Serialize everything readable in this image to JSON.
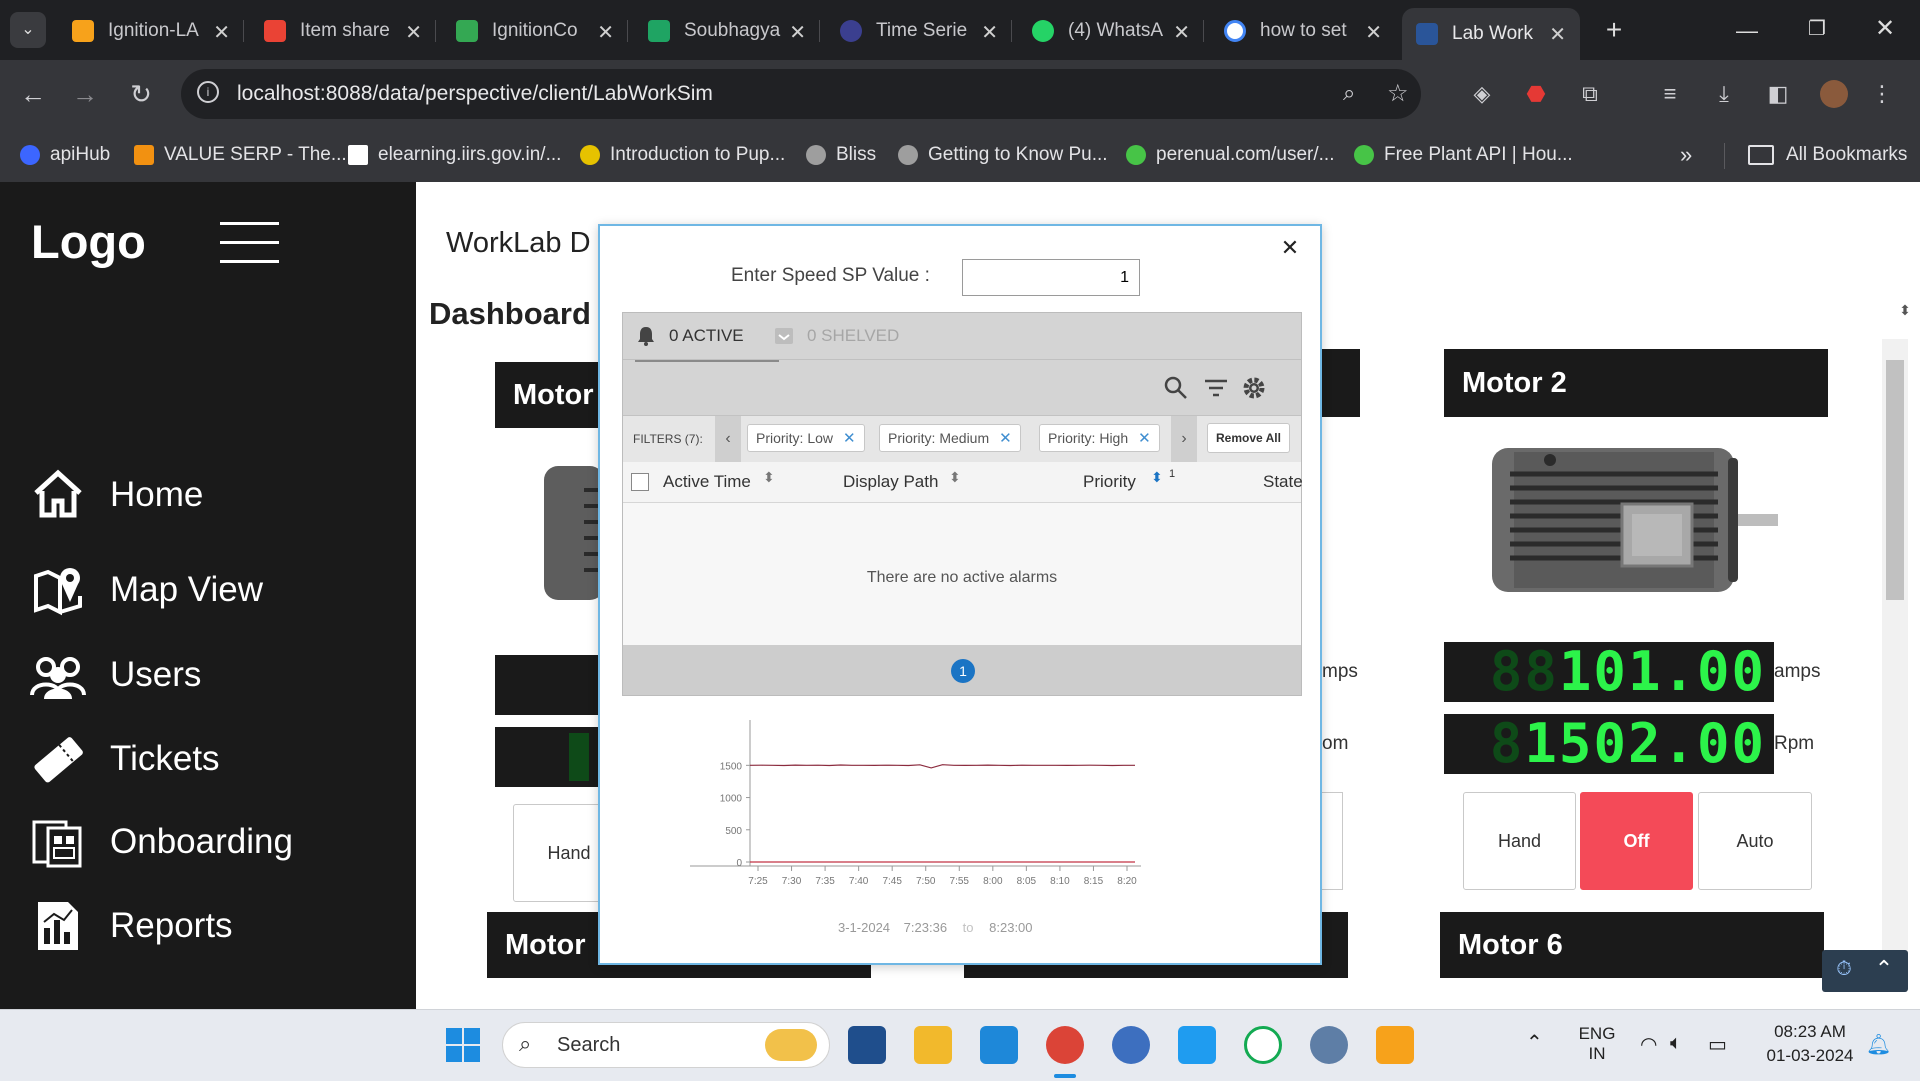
{
  "browser": {
    "tabs": [
      {
        "title": "Ignition-LA",
        "active": false,
        "icon_color": "#f7a21b"
      },
      {
        "title": "Item share",
        "active": false,
        "icon_color": "#ea4335"
      },
      {
        "title": "IgnitionCo",
        "active": false,
        "icon_color": "#34a853"
      },
      {
        "title": "Soubhagya",
        "active": false,
        "icon_color": "#1fa463"
      },
      {
        "title": "Time Serie",
        "active": false,
        "icon_color": "#3b3f8f"
      },
      {
        "title": "(4) WhatsA",
        "active": false,
        "icon_color": "#25d366"
      },
      {
        "title": "how to set",
        "active": false,
        "icon_color": "#4285f4"
      },
      {
        "title": "Lab Work",
        "active": true,
        "icon_color": "#2a5599"
      }
    ],
    "new_tab_label": "+",
    "url": "localhost:8088/data/perspective/client/LabWorkSim",
    "bookmarks": [
      {
        "label": "apiHub",
        "icon_color": "#3c66ff"
      },
      {
        "label": "VALUE SERP - The...",
        "icon_color": "#f29111"
      },
      {
        "label": "elearning.iirs.gov.in/...",
        "icon_color": "#ffffff"
      },
      {
        "label": "Introduction to Pup...",
        "icon_color": "#e6c200"
      },
      {
        "label": "Bliss",
        "icon_color": "#9e9e9e"
      },
      {
        "label": "Getting to Know Pu...",
        "icon_color": "#9e9e9e"
      },
      {
        "label": "perenual.com/user/...",
        "icon_color": "#47c447"
      },
      {
        "label": "Free Plant API | Hou...",
        "icon_color": "#47c447"
      }
    ],
    "overflow_label": "»",
    "all_bookmarks_label": "All Bookmarks"
  },
  "sidebar": {
    "logo": "Logo",
    "items": [
      {
        "label": "Home",
        "icon": "home-icon"
      },
      {
        "label": "Map View",
        "icon": "map-icon"
      },
      {
        "label": "Users",
        "icon": "users-icon"
      },
      {
        "label": "Tickets",
        "icon": "ticket-icon"
      },
      {
        "label": "Onboarding",
        "icon": "onboarding-icon"
      },
      {
        "label": "Reports",
        "icon": "reports-icon"
      }
    ],
    "collapse_glyph": "‹"
  },
  "main": {
    "page_header": "WorkLab D",
    "section_title": "Dashboard",
    "motors": {
      "motor_left_title": "Motor",
      "motor_left_mode_label": "Hand",
      "motor2_title": "Motor 2",
      "motor2_amps_value": "101.00",
      "motor2_amps_ghost": "88",
      "motor2_amps_unit": "amps",
      "motor2_rpm_value": "1502.00",
      "motor2_rpm_ghost": "8",
      "motor2_rpm_unit": "Rpm",
      "middle_amps_unit": "mps",
      "middle_rpm_unit": "om",
      "mode_buttons": [
        "Hand",
        "Off",
        "Auto"
      ],
      "bottom_left_title": "Motor",
      "motor6_title": "Motor 6"
    },
    "accent_off": "#f44a58",
    "lcd_green": "#2cf34a"
  },
  "popup": {
    "speed_label": "Enter Speed SP Value :",
    "speed_value": "1",
    "alarm_table": {
      "active_tab": "0 ACTIVE",
      "shelved_tab": "0 SHELVED",
      "filters_label": "FILTERS (7):",
      "filter_chips": [
        "Priority: Low",
        "Priority: Medium",
        "Priority: High"
      ],
      "remove_all": "Remove All",
      "columns": [
        "Active Time",
        "Display Path",
        "Priority",
        "State"
      ],
      "priority_sort_index": "1",
      "empty_message": "There are no active alarms",
      "page": "1"
    },
    "chart": {
      "date": "3-1-2024",
      "start_time": "7:23:36",
      "to_label": "to",
      "end_time": "8:23:00"
    }
  },
  "chart_data": {
    "type": "line",
    "x_ticks": [
      "7:25",
      "7:30",
      "7:35",
      "7:40",
      "7:45",
      "7:50",
      "7:55",
      "8:00",
      "8:05",
      "8:10",
      "8:15",
      "8:20"
    ],
    "y_ticks": [
      0,
      500,
      1000,
      1500
    ],
    "ylim": [
      0,
      1800
    ],
    "series": [
      {
        "color": "#8b2b3e",
        "values": [
          1500,
          1502,
          1500,
          1498,
          1503,
          1500,
          1502,
          1497,
          1505,
          1500,
          1501,
          1499,
          1502,
          1500,
          1498,
          1508,
          1460,
          1510,
          1500,
          1499,
          1501,
          1503,
          1500,
          1498,
          1502,
          1500,
          1500,
          1501,
          1499,
          1500,
          1502,
          1500,
          1498,
          1501,
          1500
        ]
      },
      {
        "color": "#c23344",
        "values": [
          0,
          0,
          0,
          0,
          0,
          0,
          0,
          0,
          0,
          0,
          0,
          0
        ]
      }
    ]
  },
  "taskbar": {
    "search_label": "Search",
    "lang_top": "ENG",
    "lang_bottom": "IN",
    "time": "08:23 AM",
    "date": "01-03-2024"
  }
}
